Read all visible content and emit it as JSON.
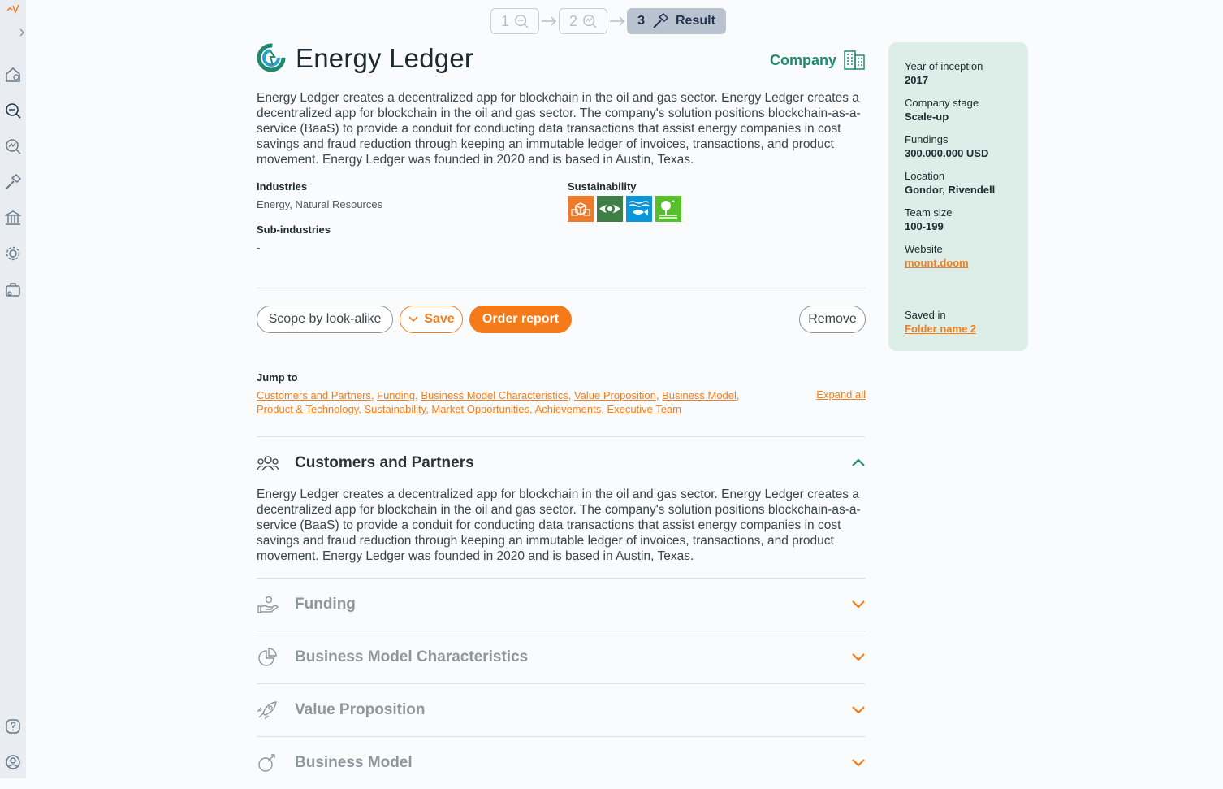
{
  "sidebar": {
    "icons": [
      "logo-icon",
      "expand-icon",
      "home-icon",
      "search-icon",
      "analytics-icon",
      "hammer-icon",
      "bank-icon",
      "settings-icon",
      "briefcase-icon",
      "help-icon",
      "user-icon"
    ]
  },
  "stepper": {
    "step1": "1",
    "step2": "2",
    "step3_num": "3",
    "step3_label": "Result"
  },
  "company": {
    "name": "Energy Ledger",
    "type": "Company",
    "description": "Energy Ledger creates a decentralized app for blockchain in the oil and gas sector. Energy Ledger creates a decentralized app for blockchain in the oil and gas sector. The company's solution positions blockchain-as-a-service (BaaS) to provide a conduit for conducting data transactions that assist energy companies in cost savings and fraud reduction through keeping an immutable ledger of invoices, transactions, and product movement. Energy Ledger was founded in 2020 and is based in Austin, Texas.",
    "industries_label": "Industries",
    "industries_value": "Energy, Natural Resources",
    "subindustries_label": "Sub-industries",
    "subindustries_value": "-",
    "sustainability_label": "Sustainability",
    "sdg_colors": [
      "#ee7b2a",
      "#3f7e44",
      "#0a97d9",
      "#56c02b"
    ]
  },
  "actions": {
    "scope": "Scope by look-alike",
    "save": "Save",
    "order": "Order report",
    "remove": "Remove"
  },
  "jump": {
    "label": "Jump to",
    "expand_all": "Expand all",
    "links": [
      "Customers and Partners",
      "Funding",
      "Business Model Characteristics",
      "Value Proposition",
      "Business Model",
      "Product & Technology",
      "Sustainability",
      "Market Opportunities",
      "Achievements",
      "Executive Team"
    ]
  },
  "sections": [
    {
      "title": "Customers and Partners",
      "icon": "people-icon",
      "open": true,
      "body": "Energy Ledger creates a decentralized app for blockchain in the oil and gas sector. Energy Ledger creates a decentralized app for blockchain in the oil and gas sector. The company's solution positions blockchain-as-a-service (BaaS) to provide a conduit for conducting data transactions that assist energy companies in cost savings and fraud reduction through keeping an immutable ledger of invoices, transactions, and product movement. Energy Ledger was founded in 2020 and is based in Austin, Texas."
    },
    {
      "title": "Funding",
      "icon": "hand-coin-icon",
      "open": false
    },
    {
      "title": "Business Model Characteristics",
      "icon": "pie-chart-icon",
      "open": false
    },
    {
      "title": "Value Proposition",
      "icon": "rocket-icon",
      "open": false
    },
    {
      "title": "Business Model",
      "icon": "business-model-icon",
      "open": false
    }
  ],
  "panel": {
    "inception_label": "Year of inception",
    "inception_value": "2017",
    "stage_label": "Company stage",
    "stage_value": "Scale-up",
    "fundings_label": "Fundings",
    "fundings_value": "300.000.000 USD",
    "location_label": "Location",
    "location_value": "Gondor, Rivendell",
    "team_label": "Team size",
    "team_value": "100-199",
    "website_label": "Website",
    "website_value": "mount.doom",
    "saved_label": "Saved in",
    "saved_value": "Folder name 2"
  },
  "colors": {
    "accent": "#f47a1a",
    "brand_green": "#1f8a70",
    "panel_bg": "#dceee7"
  }
}
